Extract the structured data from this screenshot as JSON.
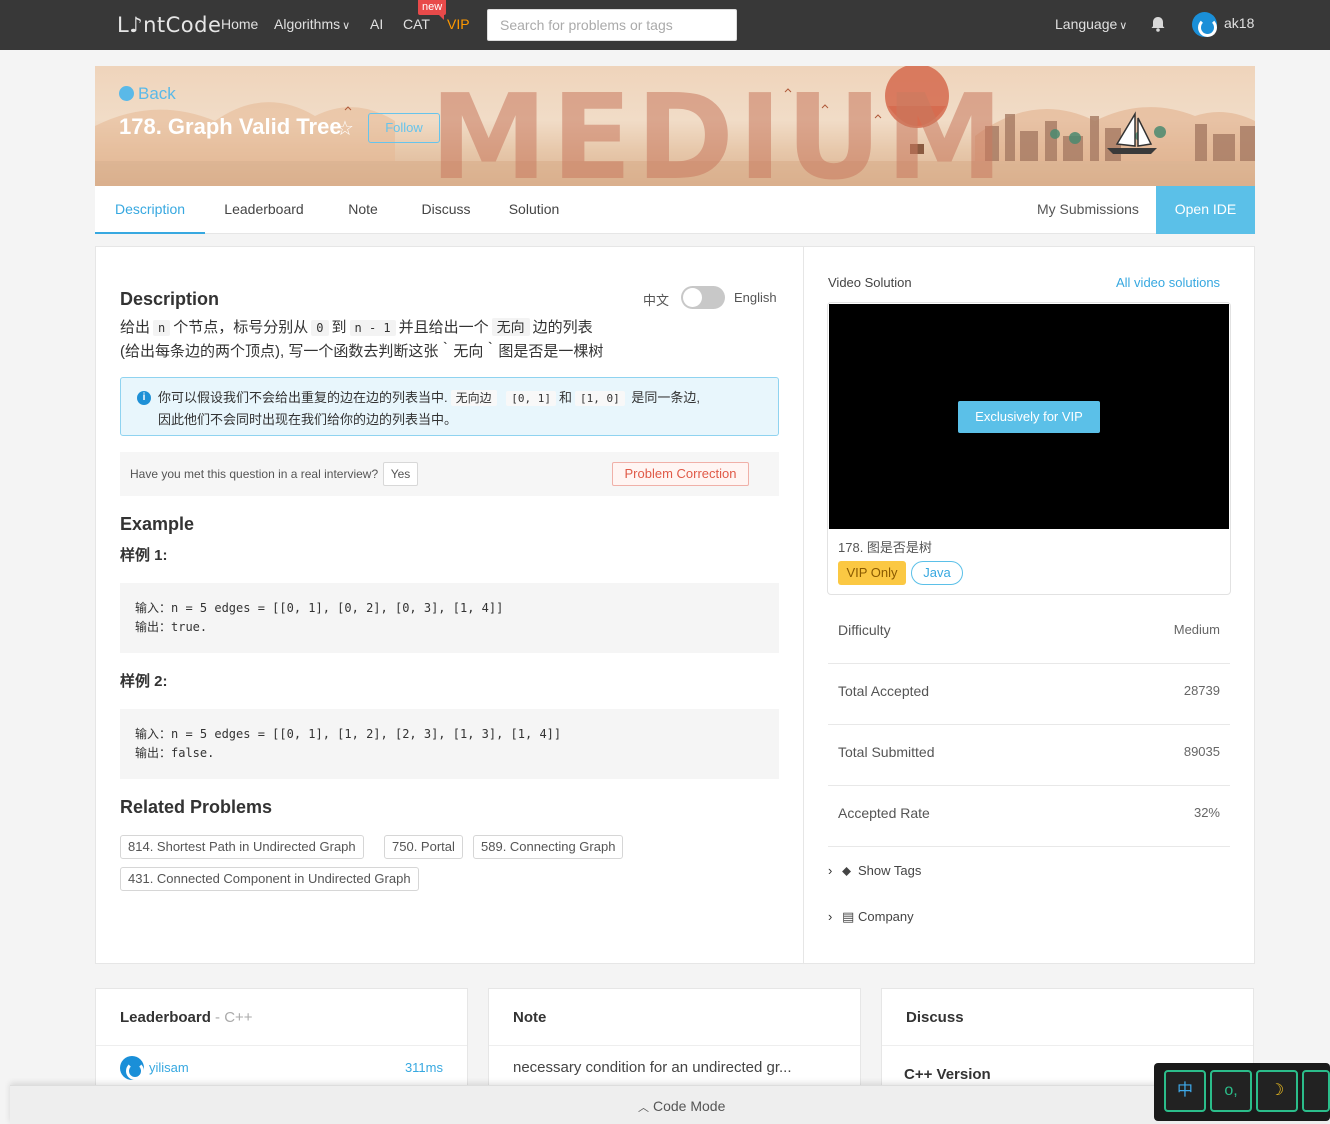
{
  "nav": {
    "logo": "L♪ntCode",
    "links": [
      "Home",
      "Algorithms",
      "AI",
      "CAT",
      "VIP"
    ],
    "new_badge": "new",
    "search_placeholder": "Search for problems or tags",
    "language": "Language",
    "username": "ak18"
  },
  "banner": {
    "back": "Back",
    "title": "178. Graph Valid Tree",
    "follow": "Follow",
    "difficulty_word": "MEDIUM"
  },
  "tabs": [
    "Description",
    "Leaderboard",
    "Note",
    "Discuss",
    "Solution"
  ],
  "my_submissions": "My Submissions",
  "open_ide": "Open IDE",
  "description": {
    "heading": "Description",
    "toggle_cn": "中文",
    "toggle_en": "English",
    "line1_parts": [
      "给出",
      "n",
      "个节点，标号分别从",
      "0",
      "到",
      "n - 1",
      "并且给出一个",
      "无向",
      "边的列表"
    ],
    "line2": "(给出每条边的两个顶点), 写一个函数去判断这张｀无向｀图是否是一棵树",
    "note_parts": [
      "你可以假设我们不会给出重复的边在边的列表当中.",
      "无向边",
      "[0, 1]",
      "和",
      "[1, 0]",
      "是同一条边,"
    ],
    "note_line2": "因此他们不会同时出现在我们给你的边的列表当中。",
    "interview_question": "Have you met this question in a real interview?",
    "yes": "Yes",
    "problem_correction": "Problem Correction"
  },
  "examples": {
    "heading": "Example",
    "items": [
      {
        "label": "样例 1:",
        "input": "输入：n = 5 edges = [[0, 1], [0, 2], [0, 3], [1, 4]]",
        "output": "输出：true."
      },
      {
        "label": "样例 2:",
        "input": "输入：n = 5 edges = [[0, 1], [1, 2], [2, 3], [1, 3], [1, 4]]",
        "output": "输出：false."
      }
    ]
  },
  "related": {
    "heading": "Related Problems",
    "items": [
      "814. Shortest Path in Undirected Graph",
      "750. Portal",
      "589. Connecting Graph",
      "431. Connected Component in Undirected Graph"
    ]
  },
  "video": {
    "label": "Video Solution",
    "all_link": "All video solutions",
    "overlay": "Exclusively for VIP",
    "caption": "178. 图是否是树",
    "vip_only": "VIP Only",
    "lang": "Java"
  },
  "stats": [
    {
      "label": "Difficulty",
      "value": "Medium"
    },
    {
      "label": "Total Accepted",
      "value": "28739"
    },
    {
      "label": "Total Submitted",
      "value": "89035"
    },
    {
      "label": "Accepted Rate",
      "value": "32%"
    }
  ],
  "expand": {
    "tags": "Show Tags",
    "company": "Company"
  },
  "bottom": {
    "leaderboard_title": "Leaderboard",
    "leaderboard_sub": "C++",
    "lb_user": "yilisam",
    "lb_time": "311ms",
    "note_title": "Note",
    "note_snippet": "necessary condition for an undirected gr...",
    "discuss_title": "Discuss",
    "discuss_snippet": "C++ Version"
  },
  "code_mode": "Code Mode",
  "ime": [
    "中",
    "o,",
    "☽"
  ]
}
